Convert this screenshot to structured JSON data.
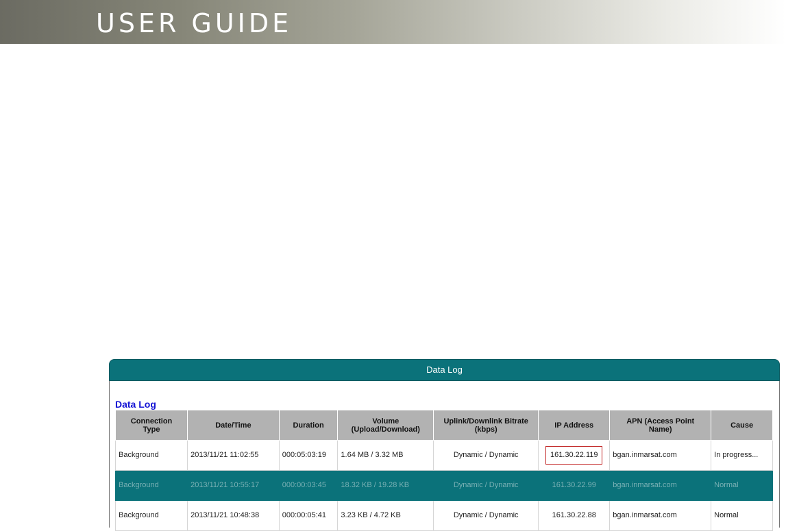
{
  "banner": {
    "title": "USER GUIDE"
  },
  "panel": {
    "header": "Data Log",
    "section_title": "Data Log"
  },
  "table": {
    "headers": [
      "Connection\nType",
      "Date/Time",
      "Duration",
      "Volume\n(Upload/Download)",
      "Uplink/Downlink Bitrate\n(kbps)",
      "IP Address",
      "APN (Access Point\nName)",
      "Cause"
    ],
    "rows": [
      {
        "type": "Background",
        "datetime": "2013/11/21 11:02:55",
        "duration": "000:05:03:19",
        "volume": "1.64 MB / 3.32 MB",
        "bitrate": "Dynamic / Dynamic",
        "ip": "161.30.22.119",
        "apn": "bgan.inmarsat.com",
        "cause": "In progress..."
      },
      {
        "type": "Background",
        "datetime": "2013/11/21 10:55:17",
        "duration": "000:00:03:45",
        "volume": "18.32 KB / 19.28 KB",
        "bitrate": "Dynamic / Dynamic",
        "ip": "161.30.22.99",
        "apn": "bgan.inmarsat.com",
        "cause": "Normal"
      },
      {
        "type": "Background",
        "datetime": "2013/11/21 10:48:38",
        "duration": "000:00:05:41",
        "volume": "3.23 KB / 4.72 KB",
        "bitrate": "Dynamic / Dynamic",
        "ip": "161.30.22.88",
        "apn": "bgan.inmarsat.com",
        "cause": "Normal"
      }
    ]
  },
  "colors": {
    "accent": "#0b727a",
    "title": "#1414d4",
    "highlight_border": "#c02020"
  }
}
